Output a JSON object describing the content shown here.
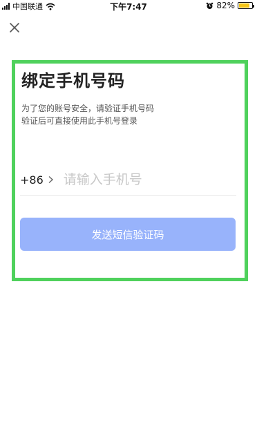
{
  "status_bar": {
    "carrier": "中国联通",
    "time": "下午7:47",
    "battery_text": "82%",
    "battery_level": 0.82,
    "icons": [
      "signal-icon",
      "wifi-icon",
      "alarm-icon",
      "battery-icon"
    ]
  },
  "header": {
    "close_icon": "close-icon"
  },
  "main": {
    "title": "绑定手机号码",
    "description_line1": "为了您的账号安全，请验证手机号码",
    "description_line2": "验证后可直接使用此手机号登录",
    "country_code": "+86",
    "phone_placeholder": "请输入手机号",
    "phone_value": "",
    "send_button_label": "发送短信验证码"
  },
  "colors": {
    "highlight_border": "#4fd15c",
    "button_bg": "#98b3fb",
    "battery": "#f5c518"
  }
}
